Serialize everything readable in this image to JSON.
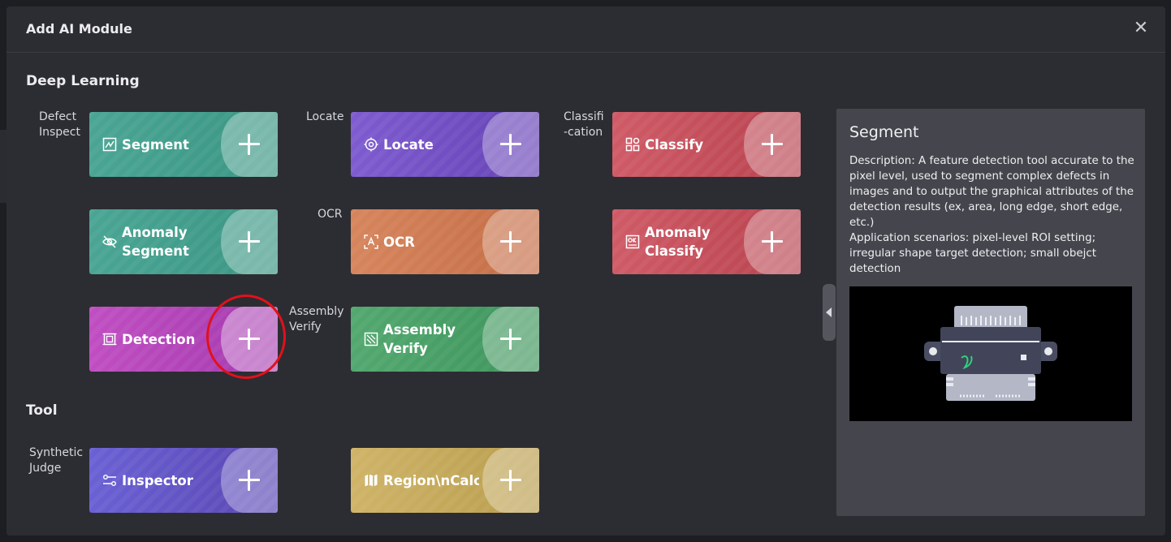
{
  "dialog": {
    "title": "Add AI Module",
    "close_glyph": "✕"
  },
  "sections": {
    "deep_learning": "Deep Learning",
    "tool": "Tool"
  },
  "categories": {
    "defect_inspect": "Defect\nInspect",
    "locate": "Locate",
    "classification": "Classifi\n-cation",
    "ocr": "OCR",
    "assembly_verify": "Assembly\nVerify",
    "synthetic_judge": "Synthetic\nJudge"
  },
  "modules": {
    "segment": {
      "label": "Segment",
      "icon": "segment-icon"
    },
    "locate": {
      "label": "Locate",
      "icon": "crosshair-icon"
    },
    "classify": {
      "label": "Classify",
      "icon": "grid-shapes-icon"
    },
    "anomaly_segment": {
      "label": "Anomaly\nSegment",
      "icon": "eye-off-icon"
    },
    "ocr": {
      "label": "OCR",
      "icon": "text-scan-icon"
    },
    "anomaly_classify": {
      "label": "Anomaly\nClassify",
      "icon": "ok-badge-icon"
    },
    "detection": {
      "label": "Detection",
      "icon": "bounding-box-icon"
    },
    "assembly_verify": {
      "label": "Assembly\nVerify",
      "icon": "assembly-check-icon"
    },
    "inspector": {
      "label": "Inspector",
      "icon": "sliders-icon"
    },
    "region_calc": {
      "label": "Region\\nCalcu",
      "icon": "map-icon"
    }
  },
  "detail": {
    "title": "Segment",
    "description": "Description: A feature detection tool accurate to the pixel level, used to segment complex defects in images and to output the graphical attributes of the detection results (ex, area, long edge, short edge, etc.)",
    "scenarios": "Application scenarios: pixel-level ROI setting; irregular shape target detection; small obejct detection"
  },
  "colors": {
    "teal": "#3f9c89",
    "purple": "#7050c4",
    "red": "#c24e5a",
    "orange": "#cd7750",
    "magenta": "#b243b8",
    "green": "#489e65",
    "indigo": "#6254c4",
    "gold": "#c4a85a",
    "highlight": "#e3101a"
  }
}
